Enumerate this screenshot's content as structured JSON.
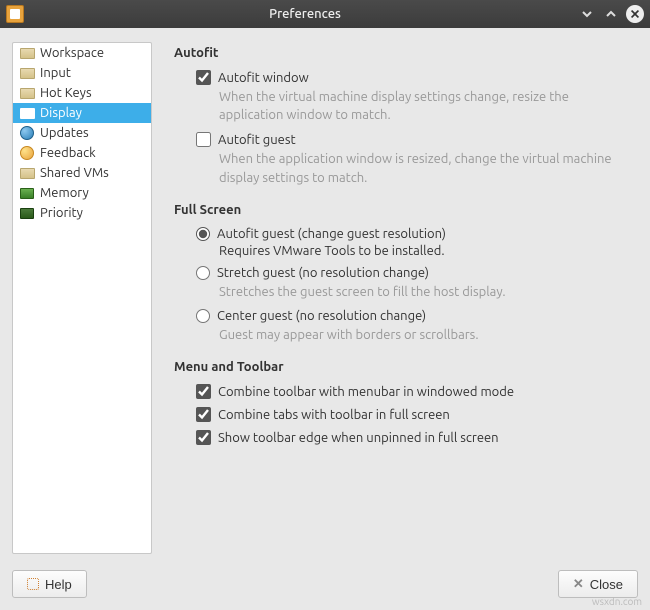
{
  "window": {
    "title": "Preferences"
  },
  "sidebar": {
    "items": [
      {
        "label": "Workspace",
        "icon": "folder"
      },
      {
        "label": "Input",
        "icon": "folder"
      },
      {
        "label": "Hot Keys",
        "icon": "folder"
      },
      {
        "label": "Display",
        "icon": "monitor",
        "selected": true
      },
      {
        "label": "Updates",
        "icon": "globe"
      },
      {
        "label": "Feedback",
        "icon": "face"
      },
      {
        "label": "Shared VMs",
        "icon": "folder"
      },
      {
        "label": "Memory",
        "icon": "chip"
      },
      {
        "label": "Priority",
        "icon": "tasks"
      }
    ]
  },
  "sections": {
    "autofit": {
      "title": "Autofit",
      "window": {
        "label": "Autofit window",
        "checked": true,
        "desc": "When the virtual machine display settings change, resize the application window to match."
      },
      "guest": {
        "label": "Autofit guest",
        "checked": false,
        "desc": "When the application window is resized, change the virtual machine display settings to match."
      }
    },
    "fullscreen": {
      "title": "Full Screen",
      "autofit": {
        "label": "Autofit guest (change guest resolution)",
        "checked": true,
        "sub": "Requires VMware Tools to be installed."
      },
      "stretch": {
        "label": "Stretch guest (no resolution change)",
        "checked": false,
        "desc": "Stretches the guest screen to fill the host display."
      },
      "center": {
        "label": "Center guest (no resolution change)",
        "checked": false,
        "desc": "Guest may appear with borders or scrollbars."
      }
    },
    "menu": {
      "title": "Menu and Toolbar",
      "combine_toolbar": {
        "label": "Combine toolbar with menubar in windowed mode",
        "checked": true
      },
      "combine_tabs": {
        "label": "Combine tabs with toolbar in full screen",
        "checked": true
      },
      "show_edge": {
        "label": "Show toolbar edge when unpinned in full screen",
        "checked": true
      }
    }
  },
  "footer": {
    "help": "Help",
    "close": "Close"
  },
  "watermark": "wsxdn.com"
}
